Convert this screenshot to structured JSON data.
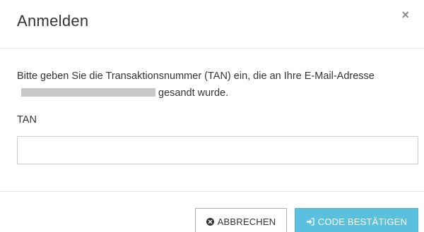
{
  "dialog": {
    "title": "Anmelden",
    "close_icon": "×"
  },
  "body": {
    "message_part1": "Bitte geben Sie die Transaktionsnummer (TAN) ein, die an Ihre E-Mail-Adresse",
    "message_part2": "gesandt wurde.",
    "tan_label": "TAN",
    "tan_value": ""
  },
  "footer": {
    "cancel_label": "ABBRECHEN",
    "cancel_icon": "times-circle-icon",
    "confirm_label": "CODE BESTÄTIGEN",
    "confirm_icon": "sign-in-icon"
  },
  "colors": {
    "confirm_button": "#5bc0de",
    "redaction": "#c8c8c8"
  }
}
